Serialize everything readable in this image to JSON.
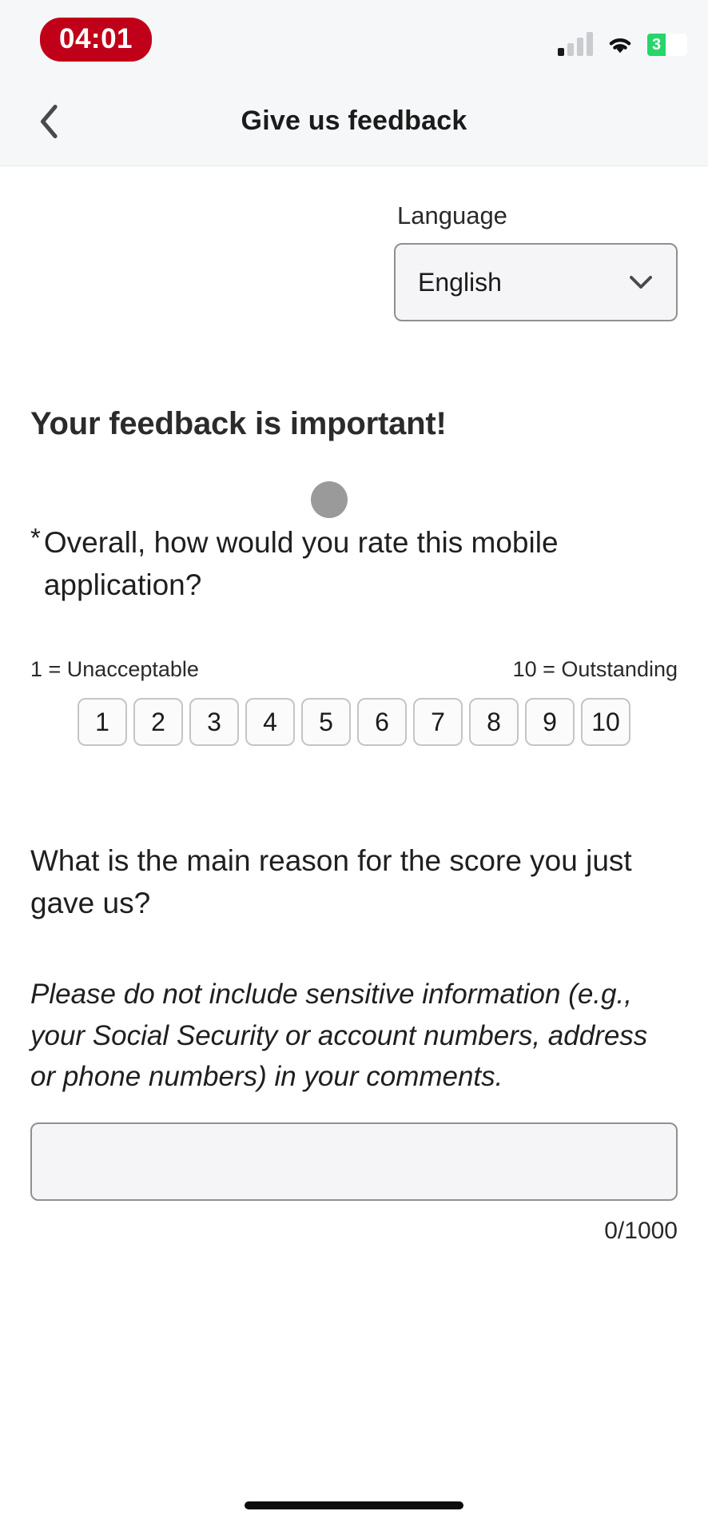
{
  "status_bar": {
    "time": "04:01",
    "time_pill_color": "#c00018",
    "signal_icon": "cellular-signal-icon",
    "signal_bars_total": 4,
    "signal_bars_active": 1,
    "wifi_icon": "wifi-icon",
    "battery_icon": "battery-icon",
    "battery_level_label": "3",
    "battery_color": "#27d56a"
  },
  "nav": {
    "back_icon": "chevron-left-icon",
    "title": "Give us feedback"
  },
  "language": {
    "label": "Language",
    "selected": "English",
    "chevron_icon": "chevron-down-icon"
  },
  "headline": "Your feedback is important!",
  "rating_question": {
    "required_marker": "*",
    "text": "Overall, how would you rate this mobile application?",
    "scale_low_label": "1 = Unacceptable",
    "scale_high_label": "10 = Outstanding",
    "options": [
      "1",
      "2",
      "3",
      "4",
      "5",
      "6",
      "7",
      "8",
      "9",
      "10"
    ],
    "selected": null
  },
  "reason_question": {
    "text": "What is the main reason for the score you just gave us?",
    "disclaimer": "Please do not include sensitive information (e.g., your Social Security or account numbers, address or phone numbers) in your comments.",
    "comment_value": "",
    "comment_placeholder": "",
    "char_count": "0/1000"
  },
  "home_indicator": "home-indicator"
}
